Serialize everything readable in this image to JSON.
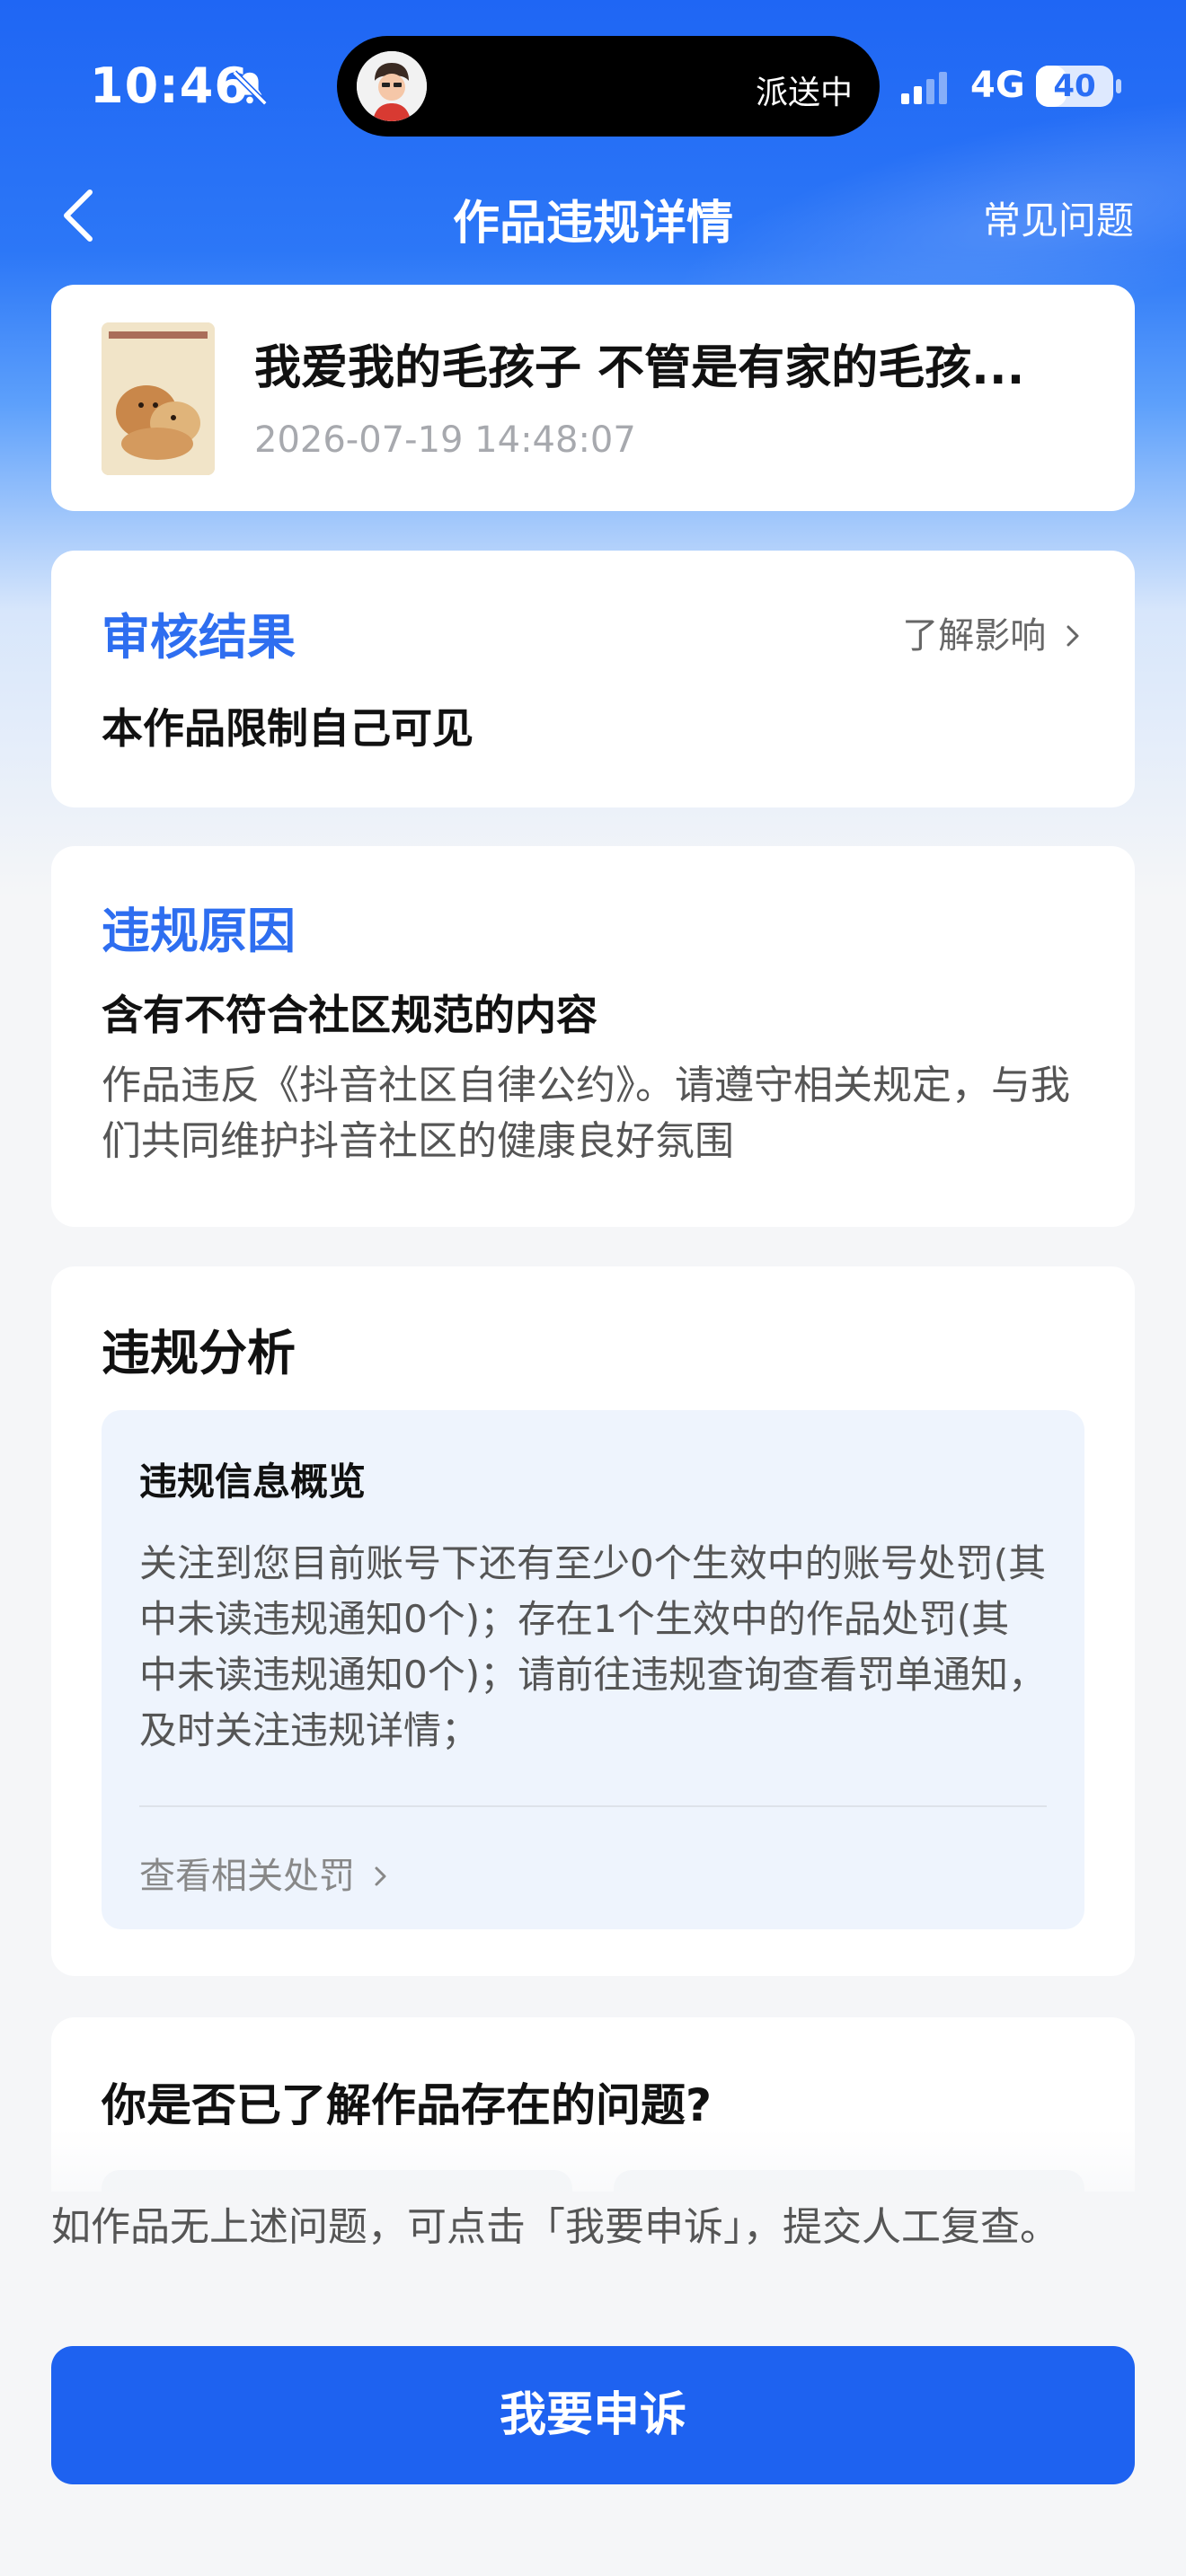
{
  "status_bar": {
    "time": "10:46",
    "live_activity": "派送中",
    "network": "4G",
    "battery": "40",
    "battery_level": 0.4
  },
  "nav": {
    "title": "作品违规详情",
    "right_link": "常见问题"
  },
  "video": {
    "title": "我爱我的毛孩子 不管是有家的毛孩...",
    "datetime": "2026-07-19 14:48:07"
  },
  "review": {
    "title": "审核结果",
    "link": "了解影响",
    "result": "本作品限制自己可见"
  },
  "reason": {
    "title": "违规原因",
    "heading": "含有不符合社区规范的内容",
    "description": "作品违反《抖音社区自律公约》。请遵守相关规定，与我们共同维护抖音社区的健康良好氛围"
  },
  "analysis": {
    "title": "违规分析",
    "overview_title": "违规信息概览",
    "overview_body": "关注到您目前账号下还有至少0个生效中的账号处罚(其中未读违规通知0个)；存在1个生效中的作品处罚(其中未读违规通知0个)；请前往违规查询查看罚单通知，及时关注违规详情；",
    "link": "查看相关处罚"
  },
  "question": {
    "title": "你是否已了解作品存在的问题?"
  },
  "footer": {
    "hint": "如作品无上述问题，可点击「我要申诉」，提交人工复查。",
    "appeal_button": "我要申诉"
  },
  "colors": {
    "accent": "#1e62f0",
    "section_title": "#2e6ef0",
    "header_gradient_top": "#1f66f4"
  },
  "icons": [
    "bell-slash-icon",
    "avatar",
    "signal-icon",
    "back-chevron-icon",
    "chevron-right-icon"
  ]
}
